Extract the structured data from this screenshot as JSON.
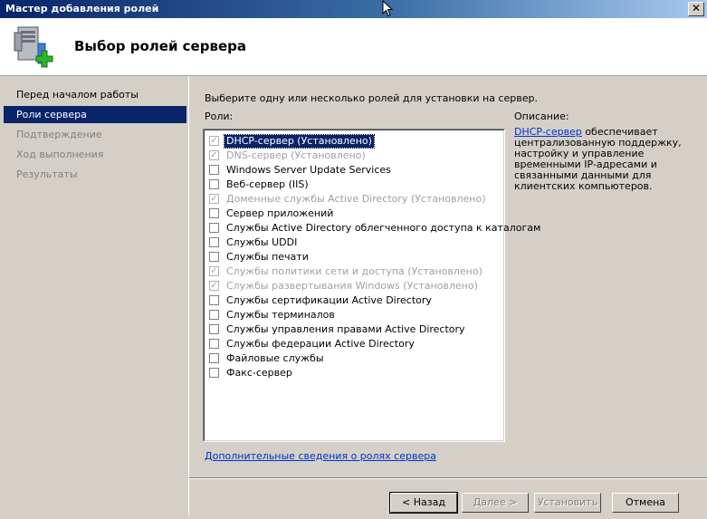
{
  "window": {
    "title": "Мастер добавления ролей",
    "close_glyph": "✕"
  },
  "header": {
    "title": "Выбор ролей сервера",
    "icon": "server-add-icon"
  },
  "nav": {
    "items": [
      {
        "label": "Перед началом работы",
        "state": "normal"
      },
      {
        "label": "Роли сервера",
        "state": "active"
      },
      {
        "label": "Подтверждение",
        "state": "disabled"
      },
      {
        "label": "Ход выполнения",
        "state": "disabled"
      },
      {
        "label": "Результаты",
        "state": "disabled"
      }
    ]
  },
  "main": {
    "instruction": "Выберите одну или несколько ролей для установки на сервер.",
    "roles_label": "Роли:",
    "description_label": "Описание:",
    "description_link": "DHCP-сервер",
    "description_text": " обеспечивает централизованную поддержку, настройку и управление временными IP-адресами и связанными данными для клиентских компьютеров.",
    "more_link": "Дополнительные сведения о ролях сервера",
    "roles": [
      {
        "label": "DHCP-сервер (Установлено)",
        "checked": true,
        "installed": true,
        "selected": true
      },
      {
        "label": "DNS-сервер (Установлено)",
        "checked": true,
        "installed": true,
        "selected": false
      },
      {
        "label": "Windows Server Update Services",
        "checked": false,
        "installed": false,
        "selected": false
      },
      {
        "label": "Веб-сервер (IIS)",
        "checked": false,
        "installed": false,
        "selected": false
      },
      {
        "label": "Доменные службы Active Directory (Установлено)",
        "checked": true,
        "installed": true,
        "selected": false
      },
      {
        "label": "Сервер приложений",
        "checked": false,
        "installed": false,
        "selected": false
      },
      {
        "label": "Службы Active Directory облегченного доступа к каталогам",
        "checked": false,
        "installed": false,
        "selected": false
      },
      {
        "label": "Службы UDDI",
        "checked": false,
        "installed": false,
        "selected": false
      },
      {
        "label": "Службы печати",
        "checked": false,
        "installed": false,
        "selected": false
      },
      {
        "label": "Службы политики сети и доступа (Установлено)",
        "checked": true,
        "installed": true,
        "selected": false
      },
      {
        "label": "Службы развертывания Windows (Установлено)",
        "checked": true,
        "installed": true,
        "selected": false
      },
      {
        "label": "Службы сертификации Active Directory",
        "checked": false,
        "installed": false,
        "selected": false
      },
      {
        "label": "Службы терминалов",
        "checked": false,
        "installed": false,
        "selected": false
      },
      {
        "label": "Службы управления правами Active Directory",
        "checked": false,
        "installed": false,
        "selected": false
      },
      {
        "label": "Службы федерации Active Directory",
        "checked": false,
        "installed": false,
        "selected": false
      },
      {
        "label": "Файловые службы",
        "checked": false,
        "installed": false,
        "selected": false
      },
      {
        "label": "Факс-сервер",
        "checked": false,
        "installed": false,
        "selected": false
      }
    ]
  },
  "buttons": {
    "back": "< Назад",
    "next": "Далее >",
    "install": "Установить",
    "cancel": "Отмена"
  },
  "colors": {
    "accent": "#0a246a",
    "link": "#0033cc",
    "plus": "#2db52d"
  }
}
